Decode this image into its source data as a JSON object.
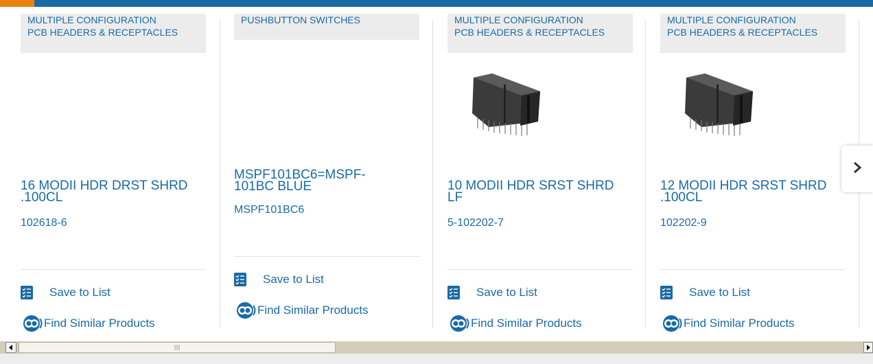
{
  "colors": {
    "accent": "#e8820c",
    "brand": "#1a6aa6",
    "category_bg": "#ececec"
  },
  "products": [
    {
      "category_lines": [
        "MULTIPLE CONFIGURATION",
        "PCB HEADERS & RECEPTACLES"
      ],
      "title_lines": [
        "16 MODII HDR DRST SHRD",
        ".100CL"
      ],
      "part_number": "102618-6",
      "has_image": false,
      "save_label": "Save to List",
      "similar_label": "Find Similar Products"
    },
    {
      "category_lines": [
        "PUSHBUTTON SWITCHES"
      ],
      "title_lines": [
        "MSPF101BC6=MSPF-",
        "101BC BLUE"
      ],
      "part_number": "MSPF101BC6",
      "has_image": false,
      "save_label": "Save to List",
      "similar_label": "Find Similar Products"
    },
    {
      "category_lines": [
        "MULTIPLE CONFIGURATION",
        "PCB HEADERS & RECEPTACLES"
      ],
      "title_lines": [
        "10 MODII HDR SRST SHRD",
        "LF"
      ],
      "part_number": "5-102202-7",
      "has_image": true,
      "save_label": "Save to List",
      "similar_label": "Find Similar Products"
    },
    {
      "category_lines": [
        "MULTIPLE CONFIGURATION",
        "PCB HEADERS & RECEPTACLES"
      ],
      "title_lines": [
        "12 MODII HDR SRST SHRD",
        ".100CL"
      ],
      "part_number": "102202-9",
      "has_image": true,
      "save_label": "Save to List",
      "similar_label": "Find Similar Products"
    }
  ],
  "carousel": {
    "next_icon": "chevron-right-icon"
  },
  "scrollbar": {
    "left_icon": "arrow-left-icon",
    "right_icon": "arrow-right-icon",
    "grip_icon": "grip-icon"
  }
}
